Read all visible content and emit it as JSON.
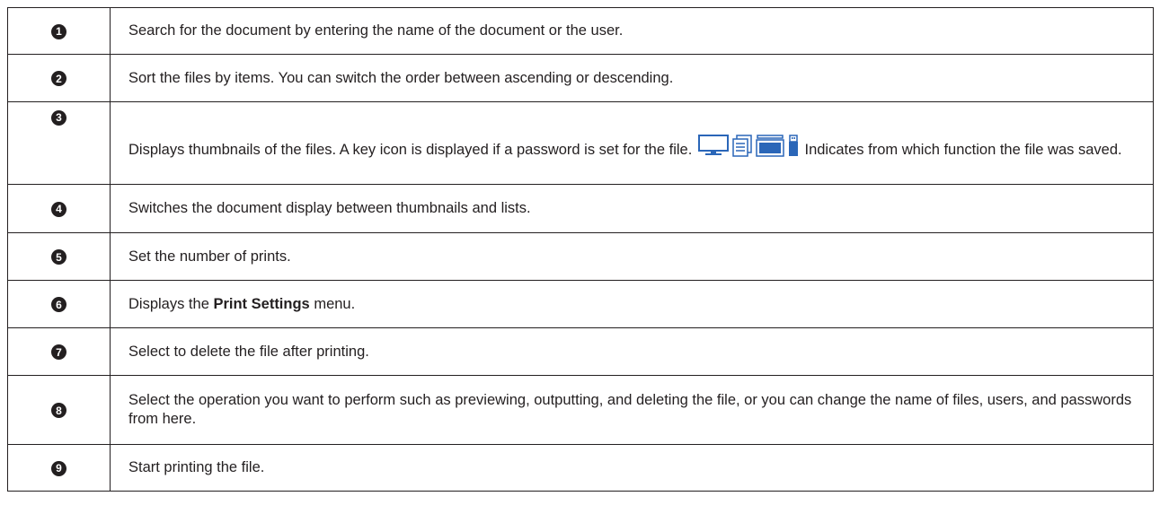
{
  "rows": [
    {
      "number": "1",
      "text": "Search for the document by entering the name of the document or the user."
    },
    {
      "number": "2",
      "text": "Sort the files by items. You can switch the order between ascending or descending."
    },
    {
      "number": "3",
      "text_before": "Displays thumbnails of the files. A key icon is displayed if a password is set for the file.",
      "text_after": "Indicates from which function the file was saved.",
      "icons": [
        "computer-icon",
        "document-icon",
        "folder-box-icon",
        "usb-memory-icon"
      ]
    },
    {
      "number": "4",
      "text": "Switches the document display between thumbnails and lists."
    },
    {
      "number": "5",
      "text": "Set the number of prints."
    },
    {
      "number": "6",
      "text_before": "Displays the",
      "bold": "Print Settings",
      "text_after": "menu."
    },
    {
      "number": "7",
      "text": "Select to delete the file after printing."
    },
    {
      "number": "8",
      "text": "Select the operation you want to perform such as previewing, outputting, and deleting the file, or you can change the name of files, users, and passwords from here."
    },
    {
      "number": "9",
      "text": "Start printing the file."
    }
  ],
  "colors": {
    "ink": "#231f20",
    "icon_blue": "#2a66b8"
  }
}
